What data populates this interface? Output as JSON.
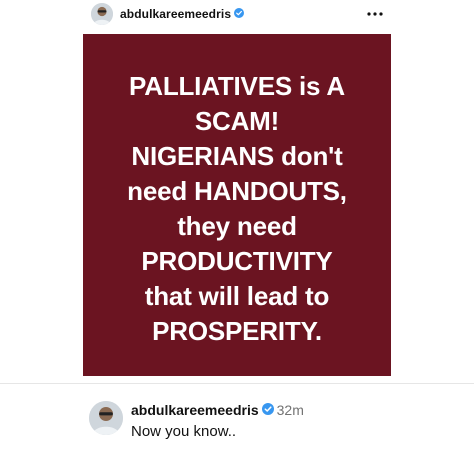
{
  "post": {
    "username": "abdulkareemeedris",
    "verified": true,
    "image_background": "#6b1421",
    "image_text_lines": [
      "PALLIATIVES is A",
      "SCAM!",
      "NIGERIANS don't",
      "need HANDOUTS,",
      "they need",
      "PRODUCTIVITY",
      "that will lead to",
      "PROSPERITY."
    ]
  },
  "caption": {
    "username": "abdulkareemeedris",
    "verified": true,
    "time": "32m",
    "text": "Now you know.."
  },
  "colors": {
    "verified_badge": "#3897f0",
    "muted_text": "#737373"
  },
  "icons": {
    "more": "three-dots-horizontal",
    "verified": "verified-badge"
  }
}
